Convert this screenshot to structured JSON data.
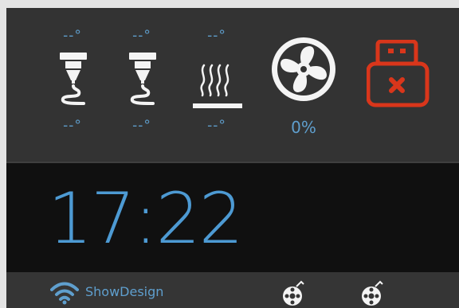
{
  "status": {
    "nozzle1": {
      "current": "--°",
      "target": "--°",
      "icon": "nozzle-icon"
    },
    "nozzle2": {
      "current": "--°",
      "target": "--°",
      "icon": "nozzle-icon"
    },
    "bed": {
      "current": "--°",
      "target": "--°",
      "icon": "heated-bed-icon"
    },
    "fan": {
      "speed": "0%",
      "icon": "fan-icon"
    },
    "usb": {
      "icon": "usb-disconnected-icon",
      "color": "#d9361b"
    }
  },
  "clock": {
    "time": "17:22"
  },
  "bottom_bar": {
    "wifi": {
      "icon": "wifi-icon",
      "ssid": "ShowDesign"
    },
    "extra_icons": [
      "spool-icon",
      "spool-icon"
    ]
  },
  "colors": {
    "accent": "#5f9fce",
    "clock": "#4d9ad3",
    "panel": "#333333",
    "clock_bg": "#101010",
    "icon_white": "#f4f4f4",
    "alert": "#d9361b"
  }
}
